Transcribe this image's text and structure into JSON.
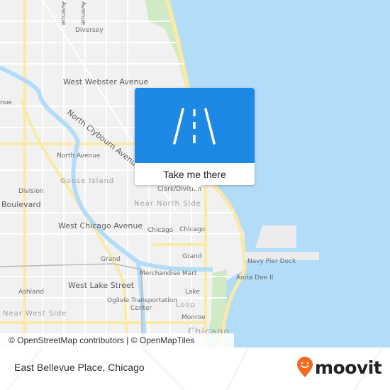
{
  "map": {
    "labels": {
      "diversey": "Diversey",
      "west_webster_avenue": "West Webster Avenue",
      "north_clybourn_avenue": "North Clybourn Avenue",
      "north_avenue": "North Avenue",
      "goose_island": "Goose Island",
      "division": "Division",
      "boulevard": "Boulevard",
      "clark_division": "Clark/Division",
      "near_north_side": "Near North Side",
      "west_chicago_avenue": "West Chicago Avenue",
      "chicago_1": "Chicago",
      "chicago_2": "Chicago",
      "grand_1": "Grand",
      "grand_2": "Grand",
      "merchandise_mart": "Merchandise Mart",
      "navy_pier_dock": "Navy Pier Dock",
      "anita_dee_ii": "Anita Dee II",
      "west_lake_street": "West Lake Street",
      "lake": "Lake",
      "ashland": "Ashland",
      "ogilvie_line1": "Ogilvie Transportation",
      "ogilvie_line2": "Center",
      "loop": "Loop",
      "near_west_side": "Near West Side",
      "monroe": "Monroe",
      "chicago_city": "Chicago",
      "avenue_top_1": "Avenue",
      "avenue_top_2": "Avenue",
      "avenue_left": "nue",
      "ue_left": "ue"
    },
    "colors": {
      "water": "#b3dcf9",
      "park": "#cfeac4",
      "land": "#f1f1f2",
      "major_road": "#fbe9a6",
      "minor_road": "#ffffff"
    }
  },
  "popup": {
    "icon": "road-icon",
    "action_label": "Take me there"
  },
  "attribution": "© OpenStreetMap contributors | © OpenMapTiles",
  "footer": {
    "place_name": "East Bellevue Place, Chicago",
    "brand": "moovit",
    "brand_color": "#f26b21"
  }
}
